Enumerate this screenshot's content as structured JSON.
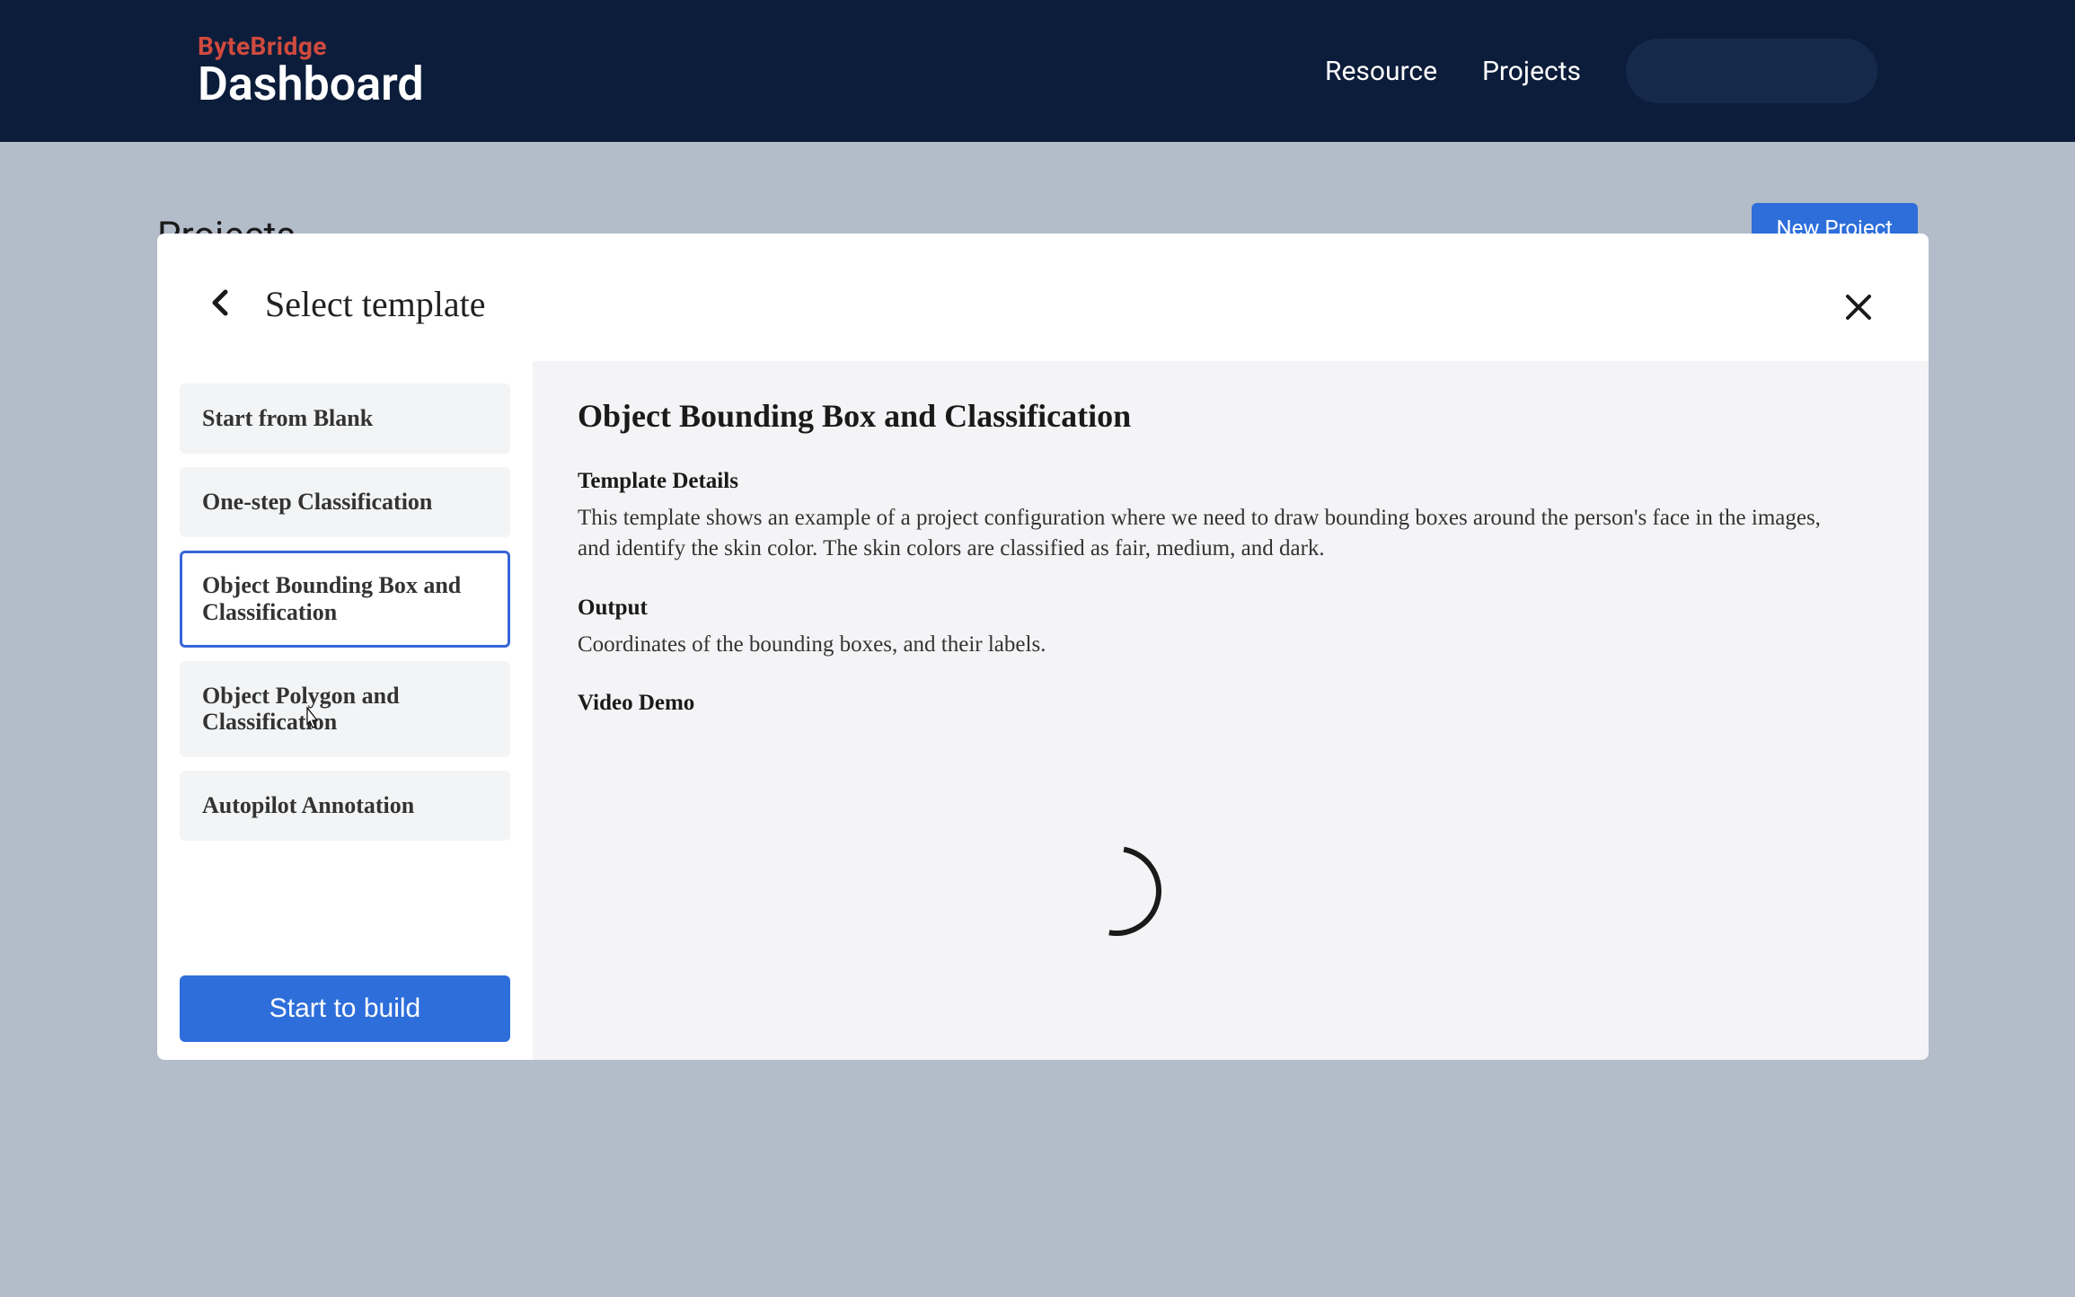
{
  "header": {
    "brand_top": "ByteBridge",
    "brand_bottom": "Dashboard",
    "nav": {
      "resource": "Resource",
      "projects": "Projects"
    }
  },
  "page": {
    "bg_title": "Projects",
    "bg_button": "New Project"
  },
  "modal": {
    "title": "Select template",
    "close_icon": "close",
    "back_icon": "chevron-left",
    "templates": [
      {
        "label": "Start from Blank",
        "selected": false
      },
      {
        "label": "One-step Classification",
        "selected": false
      },
      {
        "label": "Object Bounding Box and Classification",
        "selected": true
      },
      {
        "label": "Object Polygon and Classification",
        "selected": false
      },
      {
        "label": "Autopilot Annotation",
        "selected": false
      }
    ],
    "start_button": "Start to build",
    "details": {
      "title": "Object Bounding Box and Classification",
      "section1_title": "Template Details",
      "section1_text": "This template shows an example of a project configuration where we need to draw bounding boxes around the person's face in the images, and identify the skin color. The skin colors are classified as fair, medium, and dark.",
      "section2_title": "Output",
      "section2_text": "Coordinates of the bounding boxes, and their labels.",
      "section3_title": "Video Demo"
    }
  }
}
